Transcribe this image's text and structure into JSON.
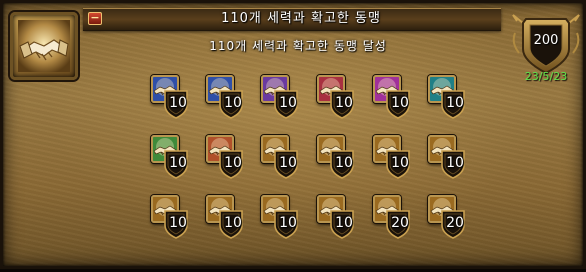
{
  "achievement": {
    "title": "110개 세력과 확고한 동맹",
    "description": "110개 세력과 확고한 동맹 달성",
    "points": "200",
    "date": "23/5/23",
    "icon": "handshake-icon",
    "collapse_label": "−"
  },
  "criteria": [
    {
      "icon": "reputation-handshake-blue",
      "value": "10"
    },
    {
      "icon": "reputation-handshake-blue",
      "value": "10"
    },
    {
      "icon": "reputation-handshake-purple",
      "value": "10"
    },
    {
      "icon": "reputation-handshake-red",
      "value": "10"
    },
    {
      "icon": "reputation-handshake-magenta",
      "value": "10"
    },
    {
      "icon": "reputation-handshake-teal",
      "value": "10"
    },
    {
      "icon": "reputation-handshake-green",
      "value": "10"
    },
    {
      "icon": "reputation-handshake-orange",
      "value": "10"
    },
    {
      "icon": "reputation-handshake-gold",
      "value": "10"
    },
    {
      "icon": "reputation-handshake-gold",
      "value": "10"
    },
    {
      "icon": "reputation-handshake-gold",
      "value": "10"
    },
    {
      "icon": "reputation-handshake-gold",
      "value": "10"
    },
    {
      "icon": "reputation-handshake-gold",
      "value": "10"
    },
    {
      "icon": "reputation-handshake-gold",
      "value": "10"
    },
    {
      "icon": "reputation-handshake-gold",
      "value": "10"
    },
    {
      "icon": "reputation-handshake-gold",
      "value": "10"
    },
    {
      "icon": "reputation-handshake-gold",
      "value": "20"
    },
    {
      "icon": "reputation-handshake-gold",
      "value": "20"
    }
  ],
  "colors": {
    "panel": "#8a6a34",
    "date_text": "#5fe04a",
    "icon_blue": "#2f4fa8",
    "icon_purple": "#6a3aa0",
    "icon_red": "#a83040",
    "icon_magenta": "#a0309a",
    "icon_teal": "#1f7f86",
    "icon_green": "#3f8a3a",
    "icon_orange": "#b0502a",
    "icon_gold": "#9a6a20"
  }
}
